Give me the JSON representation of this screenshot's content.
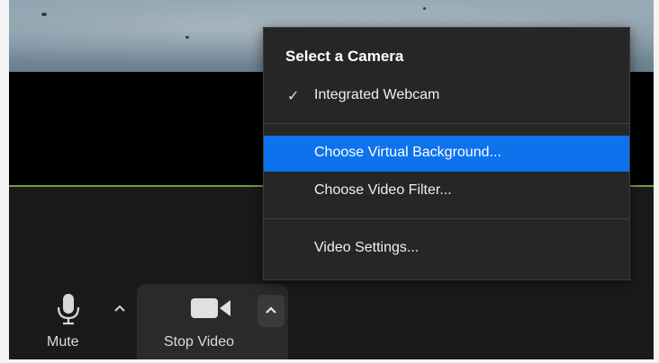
{
  "menu": {
    "heading": "Select a Camera",
    "items": [
      {
        "label": "Integrated Webcam",
        "checked": true
      },
      {
        "label": "Choose Virtual Background...",
        "highlighted": true
      },
      {
        "label": "Choose Video Filter..."
      },
      {
        "label": "Video Settings..."
      }
    ],
    "check_mark": "✓"
  },
  "toolbar": {
    "mute_label": "Mute",
    "stop_video_label": "Stop Video"
  },
  "colors": {
    "highlight": "#0e72ed",
    "menu_bg": "#262626",
    "active_speaker_border": "#6ea04a",
    "toolbar_bg": "#1a1a1a"
  },
  "icons": [
    "microphone-icon",
    "caret-up-icon",
    "video-camera-icon",
    "checkmark-icon"
  ]
}
